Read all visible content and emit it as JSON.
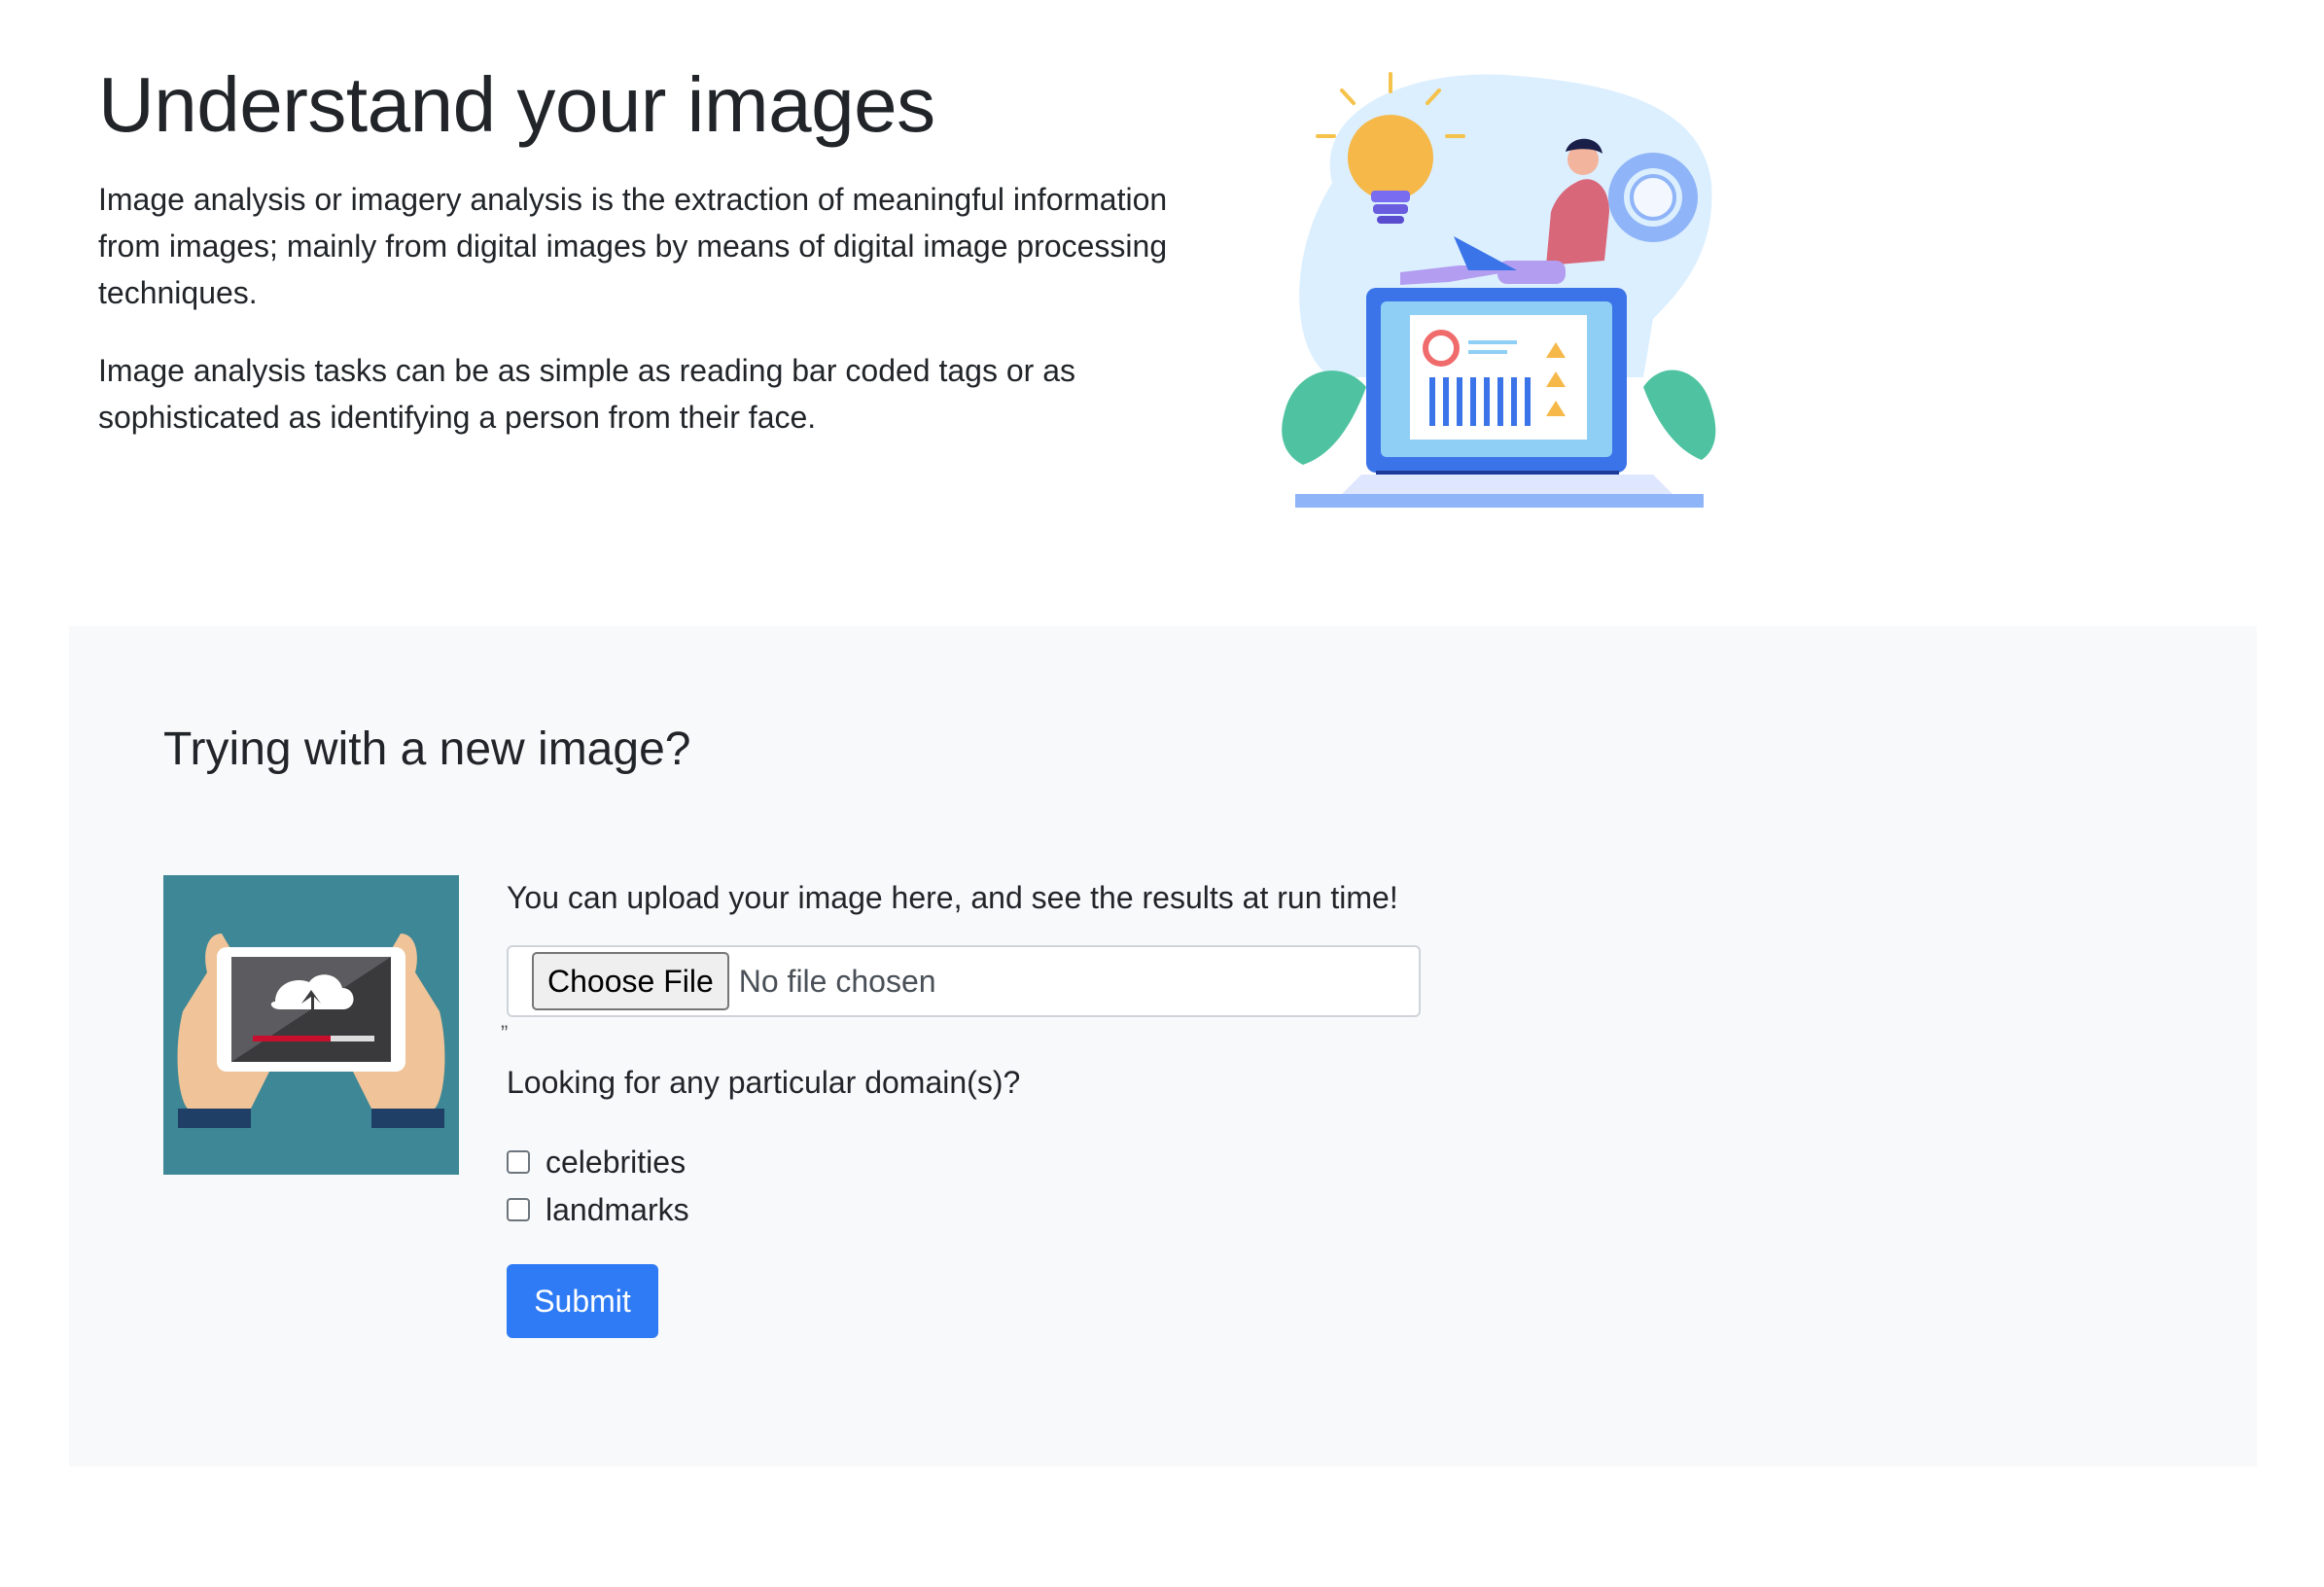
{
  "hero": {
    "title": "Understand your images",
    "paragraph1": "Image analysis or imagery analysis is the extraction of meaningful information from images; mainly from digital images by means of digital image processing techniques.",
    "paragraph2": "Image analysis tasks can be as simple as reading bar coded tags or as sophisticated as identifying a person from their face.",
    "illustration_icon": "person-on-laptop-analytics-illustration"
  },
  "panel": {
    "heading": "Trying with a new image?",
    "illustration_icon": "hands-holding-tablet-upload-illustration",
    "upload_text": "You can upload your image here, and see the results at run time!",
    "file_input": {
      "button_label": "Choose File",
      "status_text": "No file chosen"
    },
    "resize_mark": "”",
    "domain_question": "Looking for any particular domain(s)?",
    "domains": [
      {
        "label": "celebrities",
        "checked": false
      },
      {
        "label": "landmarks",
        "checked": false
      }
    ],
    "submit_label": "Submit"
  },
  "colors": {
    "primary": "#2f7bf5",
    "panel_bg": "#f8f9fa",
    "text": "#212529"
  }
}
